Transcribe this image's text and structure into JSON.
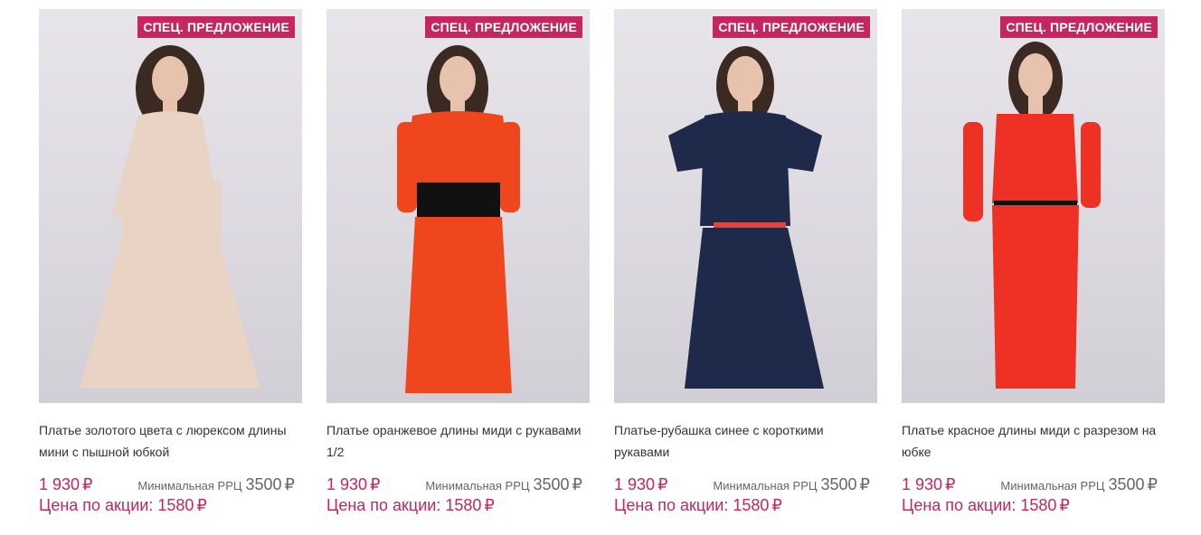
{
  "currency": "₽",
  "colors": {
    "accent": "#c7255f"
  },
  "products": [
    {
      "badge": "СПЕЦ. ПРЕДЛОЖЕНИЕ",
      "title": "Платье золотого цвета с люрексом длины мини с пышной юбкой",
      "price": "1 930",
      "rrc_label": "Минимальная РРЦ",
      "rrc_value": "3500",
      "promo_label": "Цена по акции:",
      "promo_value": "1580",
      "dress_color": "#e8d3c4"
    },
    {
      "badge": "СПЕЦ. ПРЕДЛОЖЕНИЕ",
      "title": "Платье оранжевое длины миди с рукавами 1/2",
      "price": "1 930",
      "rrc_label": "Минимальная РРЦ",
      "rrc_value": "3500",
      "promo_label": "Цена по акции:",
      "promo_value": "1580",
      "dress_color": "#f0461e"
    },
    {
      "badge": "СПЕЦ. ПРЕДЛОЖЕНИЕ",
      "title": "Платье-рубашка синее с короткими рукавами",
      "price": "1 930",
      "rrc_label": "Минимальная РРЦ",
      "rrc_value": "3500",
      "promo_label": "Цена по акции:",
      "promo_value": "1580",
      "dress_color": "#1f2a4a"
    },
    {
      "badge": "СПЕЦ. ПРЕДЛОЖЕНИЕ",
      "title": "Платье красное длины миди с разрезом на юбке",
      "price": "1 930",
      "rrc_label": "Минимальная РРЦ",
      "rrc_value": "3500",
      "promo_label": "Цена по акции:",
      "promo_value": "1580",
      "dress_color": "#ee3124"
    }
  ]
}
